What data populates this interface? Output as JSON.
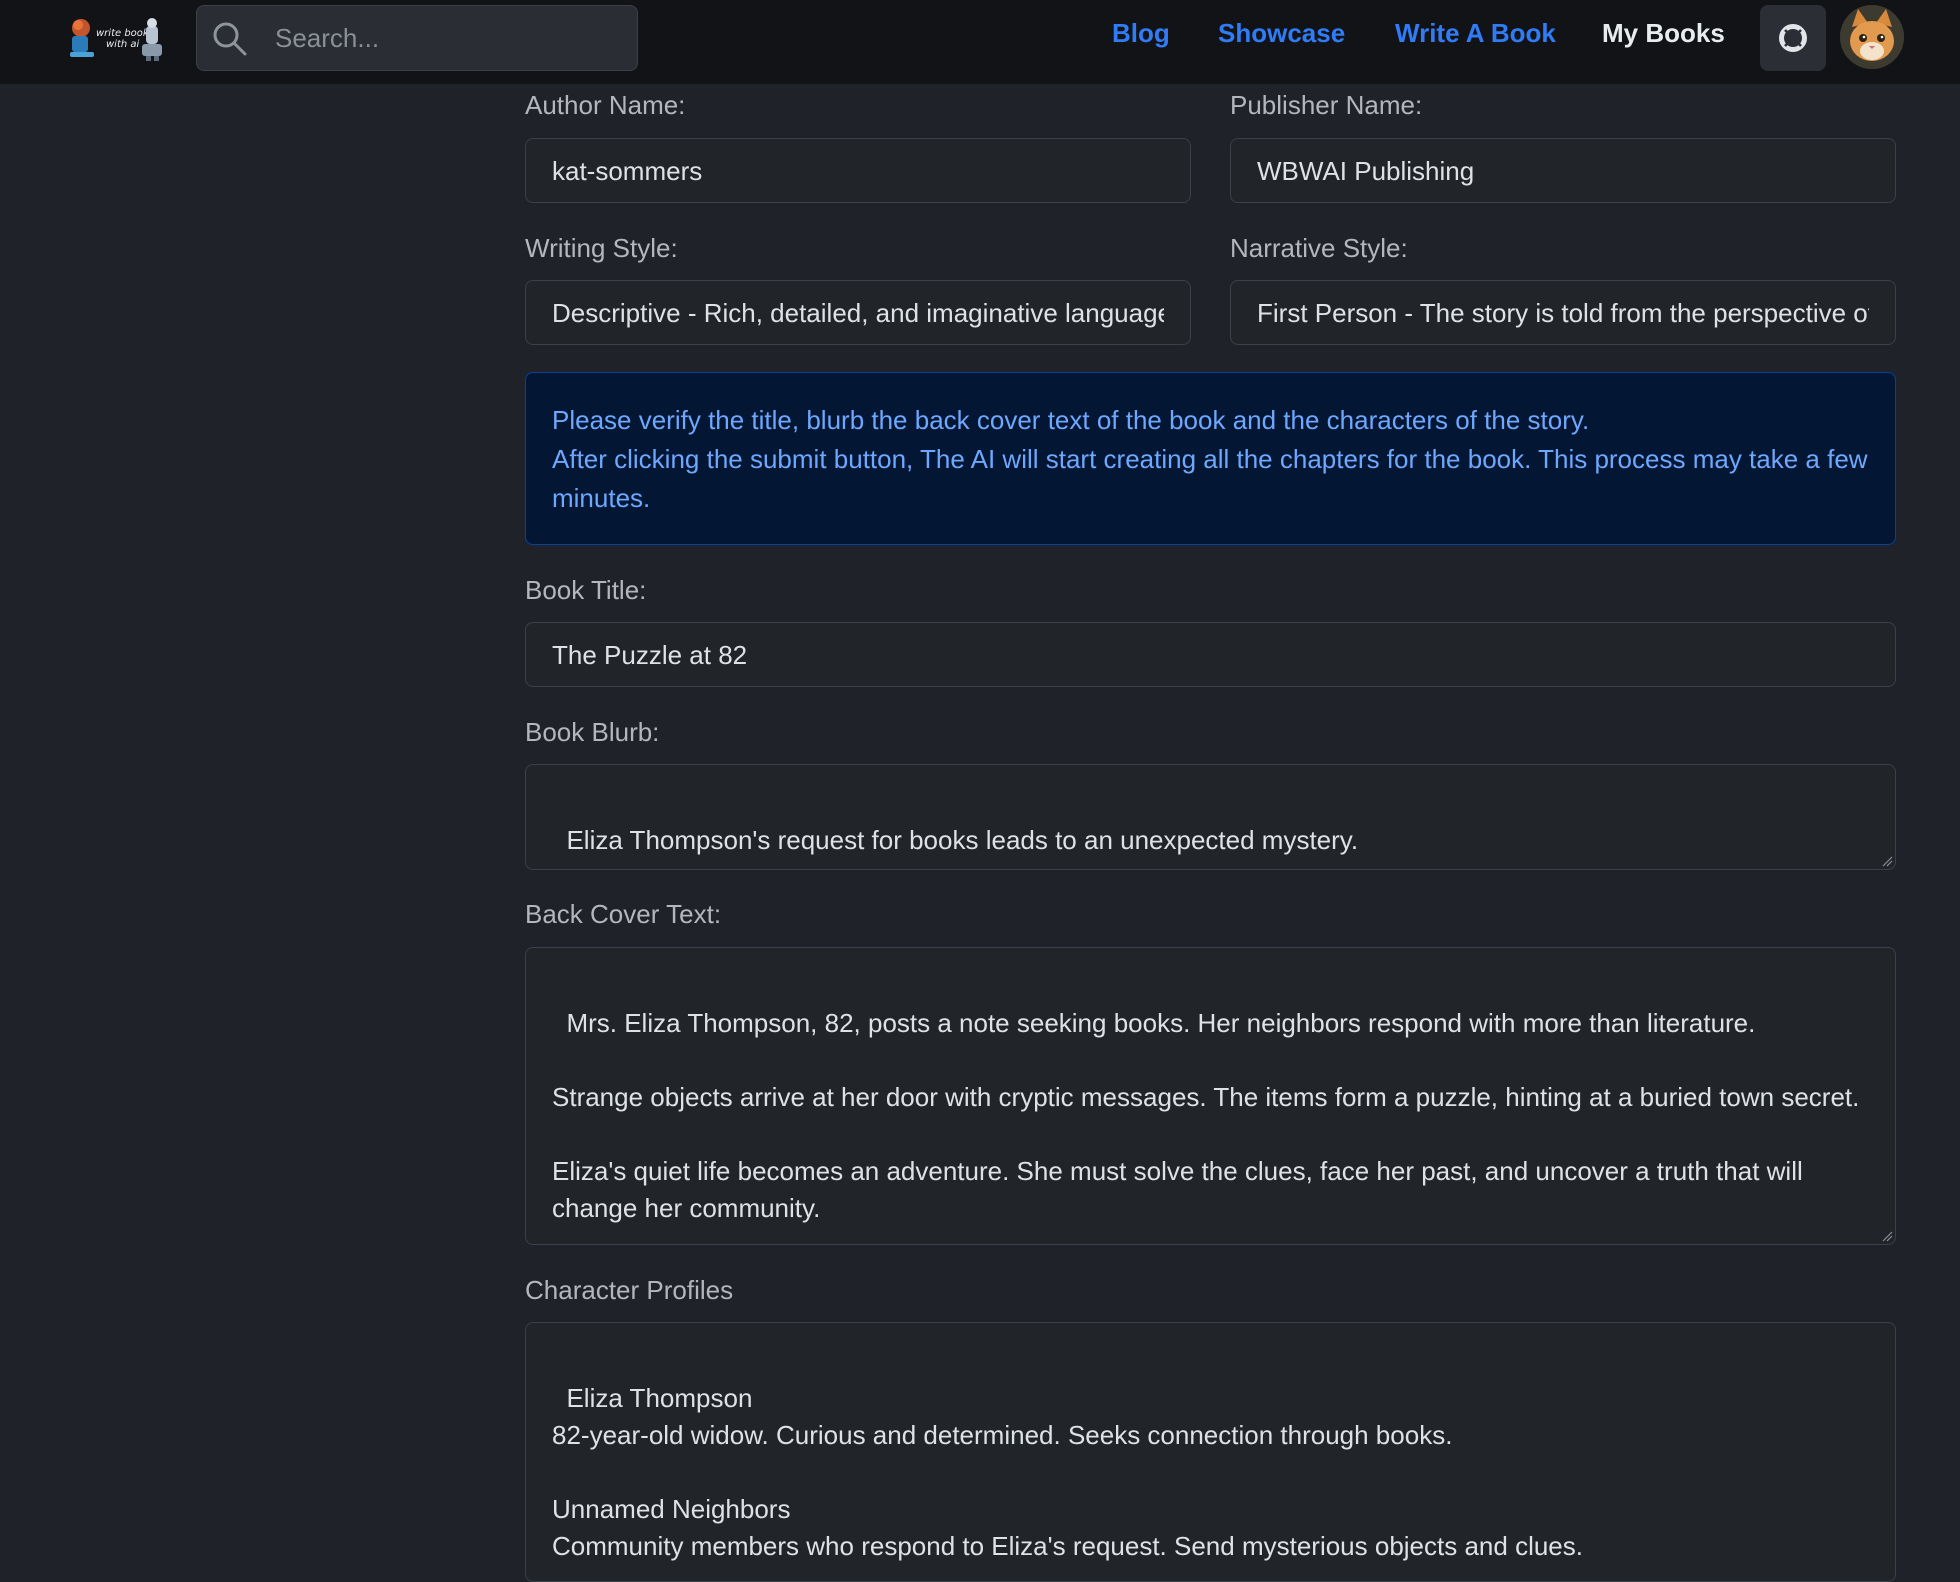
{
  "header": {
    "logo_alt": "write books with ai",
    "search": {
      "placeholder": "Search...",
      "value": ""
    },
    "nav": {
      "blog": "Blog",
      "showcase": "Showcase",
      "write_a_book": "Write A Book",
      "my_books": "My Books"
    },
    "help_icon": "life-ring-icon",
    "avatar": "cat-avatar"
  },
  "form": {
    "author_name": {
      "label": "Author Name:",
      "value": "kat-sommers"
    },
    "publisher_name": {
      "label": "Publisher Name:",
      "value": "WBWAI Publishing"
    },
    "writing_style": {
      "label": "Writing Style:",
      "value": "Descriptive - Rich, detailed, and imaginative language"
    },
    "narrative_style": {
      "label": "Narrative Style:",
      "value": "First Person - The story is told from the perspective of a character"
    },
    "notice": {
      "line1": "Please verify the title, blurb the back cover text of the book and the characters of the story.",
      "line2": "After clicking the submit button, The AI will start creating all the chapters for the book. This process may take a few minutes."
    },
    "book_title": {
      "label": "Book Title:",
      "value": "The Puzzle at 82"
    },
    "book_blurb": {
      "label": "Book Blurb:",
      "value": "Eliza Thompson's request for books leads to an unexpected mystery."
    },
    "back_cover_text": {
      "label": "Back Cover Text:",
      "value": "Mrs. Eliza Thompson, 82, posts a note seeking books. Her neighbors respond with more than literature.\n\nStrange objects arrive at her door with cryptic messages. The items form a puzzle, hinting at a buried town secret.\n\nEliza's quiet life becomes an adventure. She must solve the clues, face her past, and uncover a truth that will change her community."
    },
    "character_profiles": {
      "label": "Character Profiles",
      "value": "Eliza Thompson\n82-year-old widow. Curious and determined. Seeks connection through books.\n\nUnnamed Neighbors\nCommunity members who respond to Eliza's request. Send mysterious objects and clues."
    }
  },
  "colors": {
    "page_bg": "#1f2229",
    "navbar_bg": "#121317",
    "link_blue": "#2f7cf6",
    "alert_bg": "#031633",
    "alert_text": "#6ea8fe"
  }
}
